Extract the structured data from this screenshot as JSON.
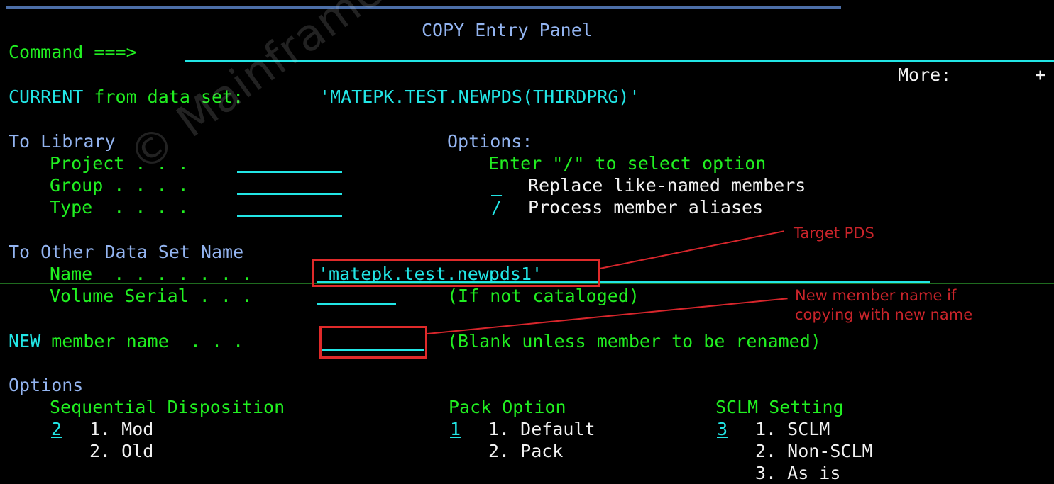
{
  "panel": {
    "title": "COPY Entry Panel",
    "more_label": "More:",
    "more_value": "+",
    "command_label": "Command ===>",
    "command_value": "",
    "current_label": "CURRENT from data set:",
    "current_value": "'MATEPK.TEST.NEWPDS(THIRDPRG)'"
  },
  "to_library": {
    "heading": "To Library",
    "fields": [
      {
        "label": "Project . . .",
        "value": ""
      },
      {
        "label": "Group . . . .",
        "value": ""
      },
      {
        "label": "Type  . . . .",
        "value": ""
      }
    ]
  },
  "options_select": {
    "heading": "Options:",
    "instruction": "Enter \"/\" to select option",
    "items": [
      {
        "mark": "_",
        "label": "Replace like-named members"
      },
      {
        "mark": "/",
        "label": "Process member aliases"
      }
    ]
  },
  "to_other": {
    "heading": "To Other Data Set Name",
    "name_label": "Name  . . . . . . .",
    "name_value": "'matepk.test.newpds1'",
    "volume_label": "Volume Serial . . .",
    "volume_value": "",
    "volume_note": "(If not cataloged)"
  },
  "new_member": {
    "prefix": "NEW",
    "label": " member name  . . .",
    "value": "",
    "note": "(Blank unless member to be renamed)"
  },
  "options_block": {
    "heading": "Options",
    "columns": [
      {
        "title": "Sequential Disposition",
        "selected": "2",
        "choices": [
          "1. Mod",
          "2. Old"
        ]
      },
      {
        "title": "Pack Option",
        "selected": "1",
        "choices": [
          "1. Default",
          "2. Pack"
        ]
      },
      {
        "title": "SCLM Setting",
        "selected": "3",
        "choices": [
          "1. SCLM",
          "2. Non-SCLM",
          "3. As is"
        ]
      }
    ]
  },
  "annotations": [
    {
      "text": "Target PDS"
    },
    {
      "text": "New member name if\ncopying with new name"
    }
  ],
  "watermark": {
    "text": "© Mainframestechhelp"
  },
  "colors": {
    "green": "#21ef21",
    "cyan": "#22e6e6",
    "blue": "#93b4f0",
    "white": "#f2f2f2",
    "red": "#d8262c",
    "background": "#000000"
  }
}
